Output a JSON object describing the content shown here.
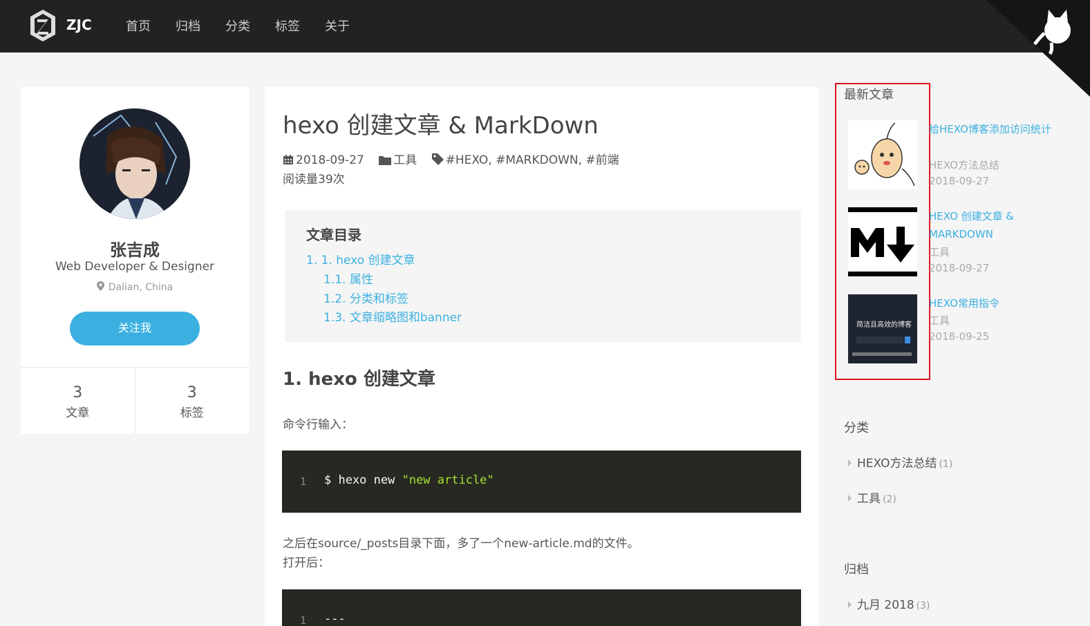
{
  "header": {
    "logo_text": "ZJC",
    "nav": [
      "首页",
      "归档",
      "分类",
      "标签",
      "关于"
    ]
  },
  "profile": {
    "name": "张吉成",
    "role": "Web Developer & Designer",
    "location": "Dalian, China",
    "follow_label": "关注我",
    "stats": [
      {
        "num": "3",
        "label": "文章"
      },
      {
        "num": "3",
        "label": "标签"
      }
    ]
  },
  "article": {
    "title": "hexo 创建文章 & MarkDown",
    "date": "2018-09-27",
    "category": "工具",
    "tags": "#HEXO, #MARKDOWN, #前端",
    "views": "阅读量39次",
    "toc_title": "文章目录",
    "toc": [
      "1. 1. hexo 创建文章",
      "1.1. 属性",
      "1.2. 分类和标签",
      "1.3. 文章缩略图和banner"
    ],
    "h2": "1. hexo 创建文章",
    "para1": "命令行输入：",
    "code1": {
      "line": "1",
      "cmd": "$ hexo new ",
      "str": "\"new article\""
    },
    "para2_line1": "之后在source/_posts目录下面，多了一个new-article.md的文件。",
    "para2_line2": "打开后：",
    "code2": {
      "line": "1",
      "text": "---"
    }
  },
  "sidebar": {
    "recent_title": "最新文章",
    "posts": [
      {
        "title": "给HEXO博客添加访问统计",
        "category": "HEXO方法总结",
        "date": "2018-09-27"
      },
      {
        "title": "HEXO 创建文章 & MARKDOWN",
        "category": "工具",
        "date": "2018-09-27"
      },
      {
        "title": "HEXO常用指令",
        "category": "工具",
        "date": "2018-09-25"
      }
    ],
    "thumb3_caption": "简洁且高效的博客",
    "categories_title": "分类",
    "categories": [
      {
        "name": "HEXO方法总结",
        "count": "(1)"
      },
      {
        "name": "工具",
        "count": "(2)"
      }
    ],
    "archive_title": "归档",
    "archives": [
      {
        "name": "九月 2018",
        "count": "(3)"
      }
    ]
  },
  "colors": {
    "accent": "#3bb0e0",
    "header_bg": "#222222",
    "highlight_border": "#e0141e",
    "code_bg": "#272822"
  }
}
